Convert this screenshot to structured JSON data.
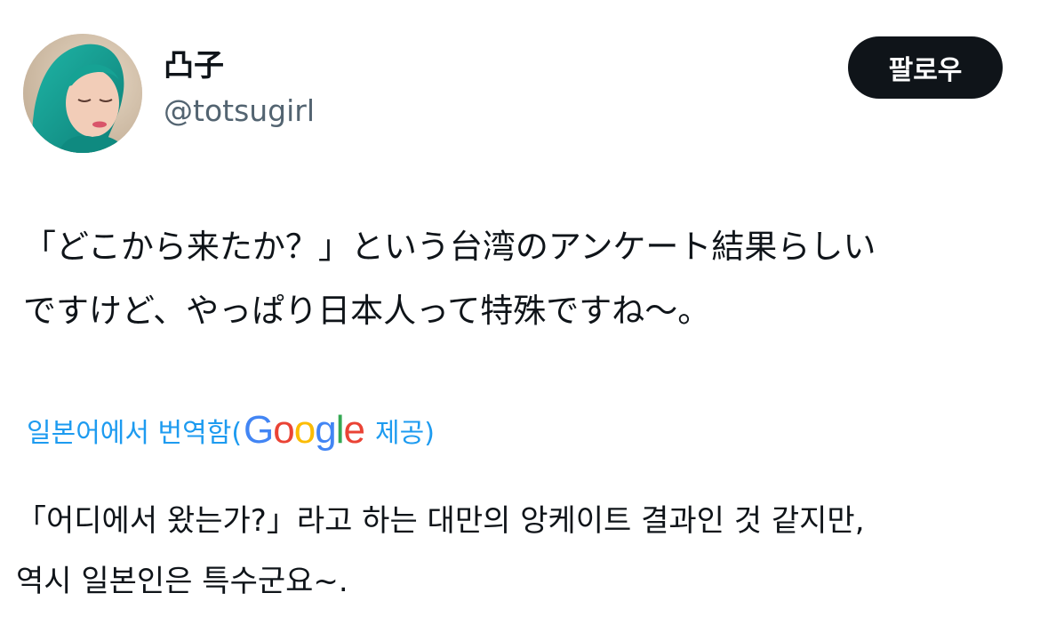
{
  "user": {
    "display_name": "凸子",
    "handle": "@totsugirl",
    "avatar_icon": "profile-photo"
  },
  "follow_button": {
    "label": "팔로우"
  },
  "tweet": {
    "lines": [
      "「どこから来たか？」という台湾のアンケート結果らしい",
      "ですけど、やっぱり日本人って特殊ですね～。"
    ]
  },
  "translation": {
    "prefix": "일본어에서 번역함(",
    "provider_logo": "Google",
    "suffix": "제공)",
    "lines": [
      "「어디에서 왔는가?」라고 하는 대만의 앙케이트 결과인 것 같지만,",
      "역시 일본인은 특수군요~."
    ]
  },
  "colors": {
    "text": "#0f1419",
    "secondary_text": "#536471",
    "link": "#1d9bf0",
    "button_bg": "#0f1419",
    "button_text": "#ffffff",
    "google_blue": "#4285f4",
    "google_red": "#ea4335",
    "google_yellow": "#fbbc05",
    "google_green": "#34a853"
  }
}
